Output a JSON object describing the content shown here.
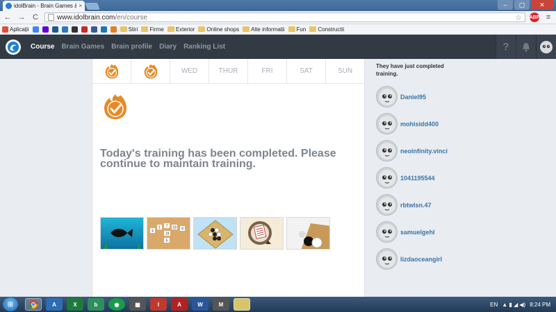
{
  "browser": {
    "tab_title": "idolBrain - Brain Games &",
    "tab_close": "×",
    "url_host": "www.idolbrain.com",
    "url_path": "/en/course",
    "window_controls": [
      "–",
      "▢",
      "✕"
    ]
  },
  "toolbar": {
    "back_glyph": "←",
    "forward_glyph": "→",
    "reload_glyph": "C",
    "star_glyph": "☆",
    "extensions": [
      "ABP",
      "≡"
    ]
  },
  "bookmarks": [
    {
      "label": "Aplicații",
      "icon": "apps-grid-icon",
      "color": "#e04e39"
    },
    {
      "label": "",
      "icon": "google-icon",
      "color": "#4285f4"
    },
    {
      "label": "",
      "icon": "yahoo-icon",
      "color": "#6001d2"
    },
    {
      "label": "",
      "icon": "bm-icon",
      "color": "#1d5a8c"
    },
    {
      "label": "",
      "icon": "bm-icon",
      "color": "#2d77c0"
    },
    {
      "label": "",
      "icon": "bm-icon",
      "color": "#333333"
    },
    {
      "label": "",
      "icon": "bm-icon",
      "color": "#c72a2a"
    },
    {
      "label": "",
      "icon": "facebook-icon",
      "color": "#3b5998"
    },
    {
      "label": "",
      "icon": "bm-icon",
      "color": "#1877b8"
    },
    {
      "label": "",
      "icon": "bm-icon",
      "color": "#e67e22"
    },
    {
      "label": "Stiri",
      "icon": "folder-icon",
      "color": "#e7c66a"
    },
    {
      "label": "Firme",
      "icon": "folder-icon",
      "color": "#e7c66a"
    },
    {
      "label": "Exterior",
      "icon": "folder-icon",
      "color": "#e7c66a"
    },
    {
      "label": "Online shops",
      "icon": "folder-icon",
      "color": "#e7c66a"
    },
    {
      "label": "Alte informatii",
      "icon": "folder-icon",
      "color": "#e7c66a"
    },
    {
      "label": "Fun",
      "icon": "folder-icon",
      "color": "#e7c66a"
    },
    {
      "label": "Constructii",
      "icon": "folder-icon",
      "color": "#e7c66a"
    }
  ],
  "site": {
    "nav": [
      "Course",
      "Brain Games",
      "Brain profile",
      "Diary",
      "Ranking List"
    ],
    "header_buttons": [
      "?",
      "🔔",
      "☺"
    ]
  },
  "week": {
    "days": [
      {
        "label": "",
        "completed": true
      },
      {
        "label": "",
        "completed": true
      },
      {
        "label": "WED",
        "completed": false
      },
      {
        "label": "THUR",
        "completed": false
      },
      {
        "label": "FRI",
        "completed": false
      },
      {
        "label": "SAT",
        "completed": false
      },
      {
        "label": "SUN",
        "completed": false
      }
    ]
  },
  "main": {
    "completed_message": "Today's training has been completed. Please continue to maintain training."
  },
  "game_thumbnails": [
    "fish-game",
    "number-tiles-game",
    "go-stones-game",
    "note-paper-game",
    "black-white-stones-game"
  ],
  "sidebar": {
    "title": "They have just completed training.",
    "users": [
      "Daniel95",
      "mohisidd400",
      "neoinfinity.vinci",
      "1041195544",
      "rbtwlsn.47",
      "samuelgehl",
      "lizdaoceangirl"
    ]
  },
  "taskbar": {
    "lang": "EN",
    "time": "8:24 PM"
  },
  "colors": {
    "accent_orange": "#e88a23",
    "header_bg": "#323a44",
    "link_blue": "#3b74a8"
  }
}
